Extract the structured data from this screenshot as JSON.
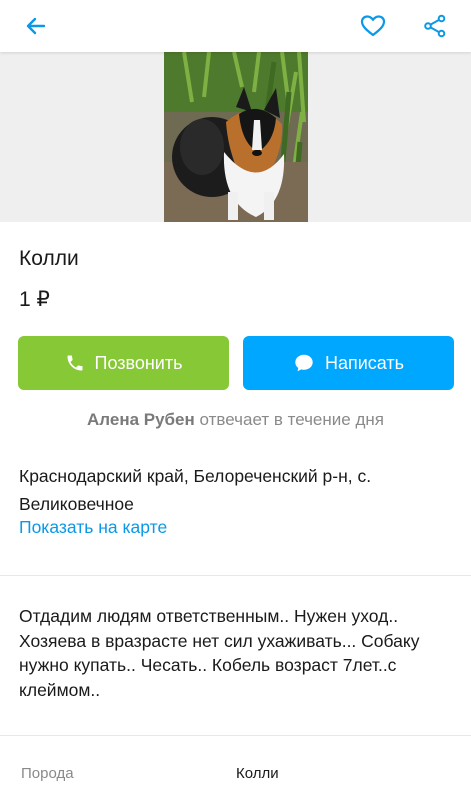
{
  "header": {
    "back_icon": "arrow-left-icon",
    "favorite_icon": "heart-icon",
    "share_icon": "share-icon",
    "accent": "#0a99e6"
  },
  "listing": {
    "title": "Колли",
    "price": "1 ₽"
  },
  "actions": {
    "call_label": "Позвонить",
    "call_color": "#86c835",
    "message_label": "Написать",
    "message_color": "#00a7ff"
  },
  "seller": {
    "name": "Алена Рубен",
    "response": "отвечает в течение дня"
  },
  "location": {
    "address": "Краснодарский край, Белореченский р-н, с. Великовечное",
    "map_link": "Показать на карте"
  },
  "description": "Отдадим людям ответственным.. Нужен уход.. Хозяева в вразрасте нет сил ухаживать... Собаку нужно купать.. Чесать.. Кобель возраст 7лет..с клеймом..",
  "params": [
    {
      "label": "Порода",
      "value": "Колли"
    }
  ]
}
